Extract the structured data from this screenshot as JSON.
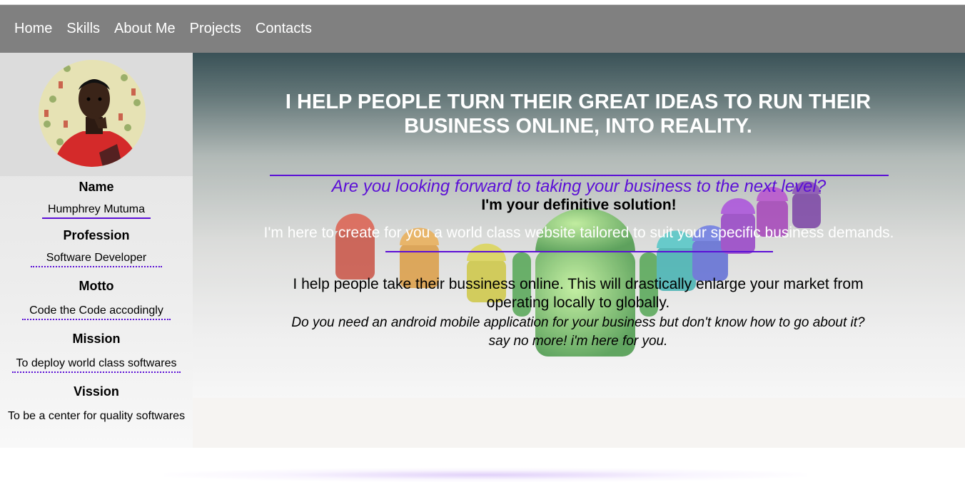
{
  "nav": {
    "items": [
      "Home",
      "Skills",
      "About Me",
      "Projects",
      "Contacts"
    ]
  },
  "sidebar": {
    "fields": [
      {
        "title": "Name",
        "value": "Humphrey Mutuma"
      },
      {
        "title": "Profession",
        "value": "Software Developer"
      },
      {
        "title": "Motto",
        "value": "Code the Code accodingly"
      },
      {
        "title": "Mission",
        "value": "To deploy world class softwares"
      },
      {
        "title": "Vission",
        "value": "To be a center for quality softwares"
      }
    ]
  },
  "hero": {
    "headline": "I HELP PEOPLE TURN THEIR GREAT IDEAS TO RUN THEIR BUSINESS ONLINE, INTO REALITY.",
    "question": "Are you looking forward to taking your business to the next level?",
    "solution": "I'm your definitive solution!",
    "promise": "I'm here to create for you a world class website tailored to suit your specific business demands.",
    "help": "I help people take their bussiness online. This will drastically enlarge your market from operating locally to globally.",
    "android_question": "Do you need an android mobile application for your business but don't know how to go about it?",
    "android_reply": "say no more! i'm here for you."
  },
  "colors": {
    "nav_bg": "#808080",
    "accent": "#5b0fd6",
    "sidebar_bg": "#e4e4e4"
  }
}
